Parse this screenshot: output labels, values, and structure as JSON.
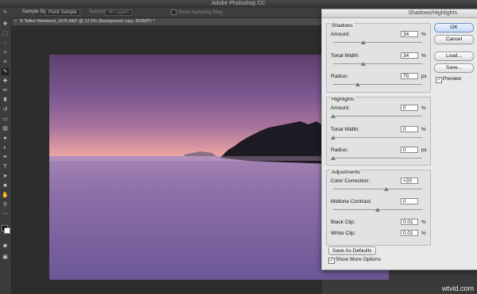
{
  "app": {
    "title": "Adobe Photoshop CC"
  },
  "options_bar": {
    "sample_size_label": "Sample Size:",
    "sample_size_value": "Point Sample",
    "sample_label": "Sample:",
    "sample_value": "All Layers",
    "show_ring_label": "Show Sampling Ring"
  },
  "document": {
    "tab_title": "© Tofino Weekend_1676.NEF @ 12.5% (Background copy, RGB/8*) *",
    "close_glyph": "×"
  },
  "dialog": {
    "title": "Shadows/Highlights",
    "shadows": {
      "title": "Shadows",
      "amount_label": "Amount:",
      "amount_value": "34",
      "amount_unit": "%",
      "amount_level": 34,
      "tonal_label": "Tonal Width:",
      "tonal_value": "34",
      "tonal_unit": "%",
      "tonal_level": 34,
      "radius_label": "Radius:",
      "radius_value": "70",
      "radius_unit": "px",
      "radius_level": 28
    },
    "highlights": {
      "title": "Highlights",
      "amount_label": "Amount:",
      "amount_value": "0",
      "amount_unit": "%",
      "tonal_label": "Tonal Width:",
      "tonal_value": "0",
      "tonal_unit": "%",
      "radius_label": "Radius:",
      "radius_value": "0",
      "radius_unit": "px"
    },
    "adjustments": {
      "title": "Adjustments",
      "color_label": "Color Correction:",
      "color_value": "+20",
      "color_level": 60,
      "midtone_label": "Midtone Contrast:",
      "midtone_value": "0",
      "midtone_level": 50,
      "black_label": "Black Clip:",
      "black_value": "0.01",
      "black_unit": "%",
      "white_label": "White Clip:",
      "white_value": "0.01",
      "white_unit": "%"
    },
    "save_defaults_label": "Save As Defaults",
    "show_more_label": "Show More Options",
    "show_more_checked": true,
    "buttons": {
      "ok": "OK",
      "cancel": "Cancel",
      "load": "Load...",
      "save": "Save..."
    },
    "preview_label": "Preview",
    "preview_checked": true
  },
  "watermark": "wtvid.com"
}
